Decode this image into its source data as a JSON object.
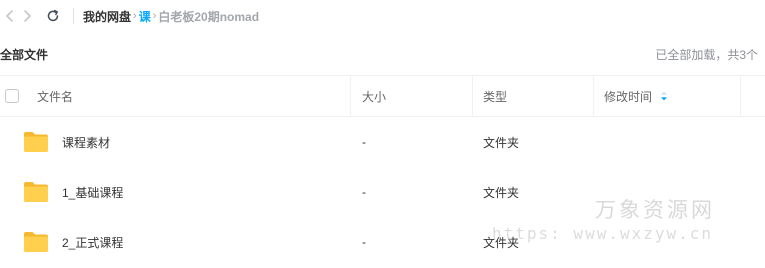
{
  "breadcrumb": {
    "root": "我的网盘",
    "middle": "课",
    "current": "白老板20期nomad"
  },
  "section": {
    "title": "全部文件",
    "status": "已全部加载，共3个"
  },
  "table": {
    "columns": {
      "name": "文件名",
      "size": "大小",
      "type": "类型",
      "modified": "修改时间"
    },
    "rows": [
      {
        "name": "课程素材",
        "size": "-",
        "type": "文件夹",
        "modified": ""
      },
      {
        "name": "1_基础课程",
        "size": "-",
        "type": "文件夹",
        "modified": ""
      },
      {
        "name": "2_正式课程",
        "size": "-",
        "type": "文件夹",
        "modified": ""
      }
    ]
  },
  "watermark": {
    "cn": "万象资源网",
    "en": "https: www.wxzyw.cn"
  },
  "colors": {
    "accent": "#06a7ff",
    "folder": "#ffc93e",
    "muted": "#a3a6ad"
  },
  "icons": {
    "back": "chevron-left-icon",
    "forward": "chevron-right-icon",
    "refresh": "refresh-icon",
    "sort": "sort-desc-icon",
    "folder": "folder-icon"
  }
}
